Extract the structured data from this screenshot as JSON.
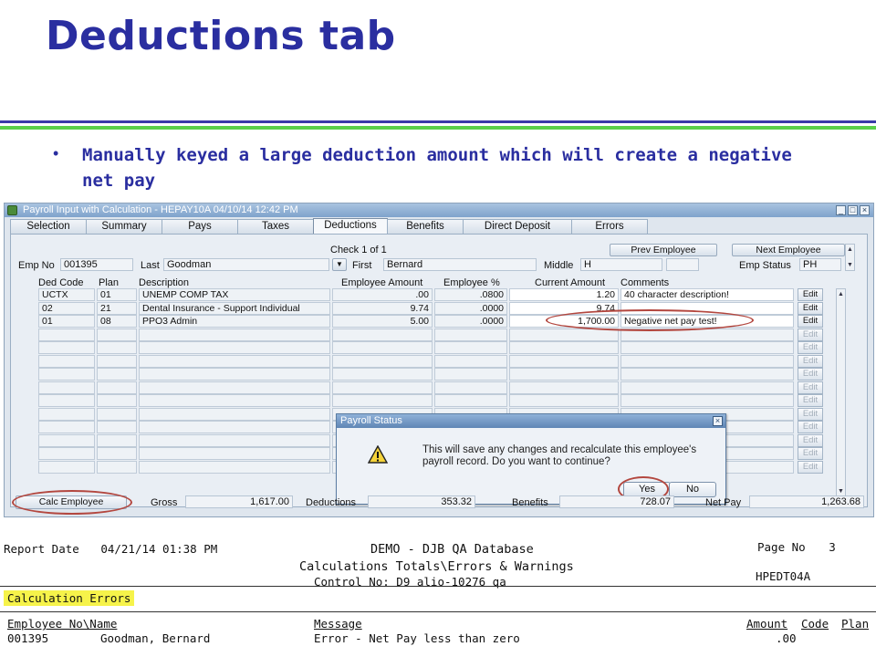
{
  "slide": {
    "title": "Deductions tab",
    "bullet_text": "Manually keyed a large deduction amount which will create a negative net pay",
    "bullet_glyph": "•"
  },
  "window": {
    "title": "Payroll Input with Calculation - HEPAY10A       04/10/14    12:42 PM",
    "buttons": [
      "_",
      "□",
      "×"
    ]
  },
  "tabs": [
    {
      "label": "Selection"
    },
    {
      "label": "Summary"
    },
    {
      "label": "Pays"
    },
    {
      "label": "Taxes"
    },
    {
      "label": "Deductions",
      "active": true
    },
    {
      "label": "Benefits"
    },
    {
      "label": "Direct Deposit"
    },
    {
      "label": "Errors"
    }
  ],
  "header": {
    "check_label": "Check 1 of 1",
    "prev_button": "Prev Employee",
    "next_button": "Next Employee",
    "emp_no_label": "Emp No",
    "emp_no_value": "001395",
    "last_label": "Last",
    "last_value": "Goodman",
    "first_label": "First",
    "first_value": "Bernard",
    "middle_label": "Middle",
    "middle_value": "H",
    "emp_status_label": "Emp Status",
    "emp_status_value": "PH"
  },
  "grid": {
    "columns": [
      "Ded Code",
      "Plan",
      "Description",
      "Employee Amount",
      "Employee %",
      "Current Amount",
      "Comments"
    ],
    "rows": [
      {
        "ded_code": "UCTX",
        "plan": "01",
        "description": "UNEMP COMP TAX",
        "employee_amount": ".00",
        "employee_pct": ".0800",
        "current_amount": "1.20",
        "comments": "40 character description!"
      },
      {
        "ded_code": "02",
        "plan": "21",
        "description": "Dental Insurance - Support Individual",
        "employee_amount": "9.74",
        "employee_pct": ".0000",
        "current_amount": "9.74",
        "comments": ""
      },
      {
        "ded_code": "01",
        "plan": "08",
        "description": "PPO3 Admin",
        "employee_amount": "5.00",
        "employee_pct": ".0000",
        "current_amount": "1,700.00",
        "comments": "Negative net pay test!"
      }
    ],
    "edit_label": "Edit"
  },
  "dialog": {
    "title": "Payroll Status",
    "message": "This will save any changes and recalculate this employee's payroll record.  Do you want to continue?",
    "yes_label": "Yes",
    "no_label": "No"
  },
  "totals": {
    "calc_button": "Calc Employee",
    "gross_label": "Gross",
    "gross_value": "1,617.00",
    "deductions_label": "Deductions",
    "deductions_value": "353.32",
    "benefits_label": "Benefits",
    "benefits_value": "728.07",
    "net_pay_label": "Net Pay",
    "net_pay_value": "1,263.68"
  },
  "report": {
    "date_label": "Report Date",
    "date_value": "04/21/14 01:38 PM",
    "db_title": "DEMO - DJB QA Database",
    "subtitle": "Calculations Totals\\Errors & Warnings",
    "control": "Control No: D9 alio-10276 qa",
    "page_label": "Page No",
    "page_value": "3",
    "report_code": "HPEDT04A",
    "section": "Calculation Errors",
    "col_emp": "Employee No\\Name",
    "col_message": "Message",
    "col_amount": "Amount",
    "col_code": "Code",
    "col_plan": "Plan",
    "row": {
      "emp_no": "001395",
      "name": "Goodman, Bernard",
      "message": "Error - Net Pay less than zero",
      "amount": ".00"
    }
  },
  "colors": {
    "title_blue": "#2a2ea0",
    "rule_green": "#5bd04a",
    "annotation_red": "#b3473f",
    "highlight_yellow": "#f6f34a"
  }
}
